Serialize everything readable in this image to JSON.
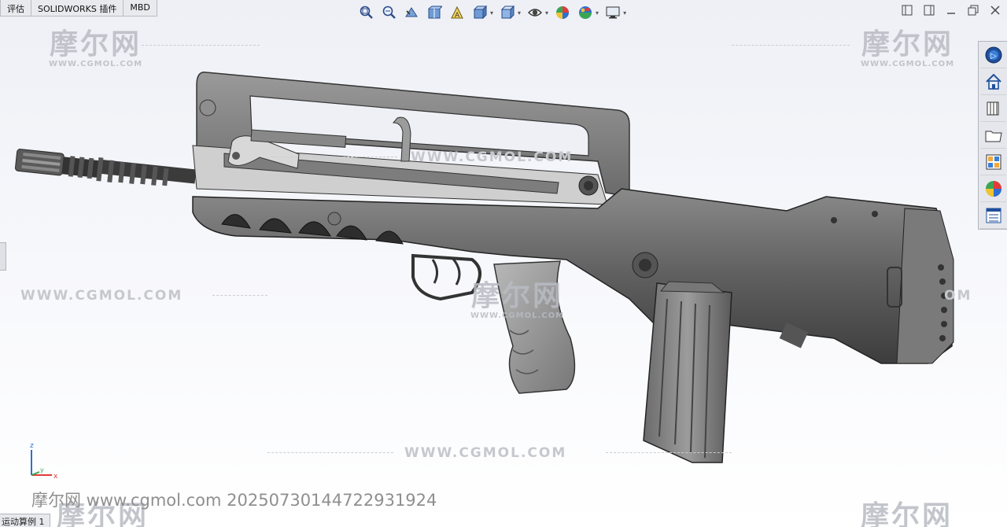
{
  "tabs": [
    "评估",
    "SOLIDWORKS 插件",
    "MBD"
  ],
  "hud_tools": [
    {
      "icon": "zoom-to-fit-icon",
      "caret": false
    },
    {
      "icon": "zoom-to-area-icon",
      "caret": false
    },
    {
      "icon": "previous-view-icon",
      "caret": false
    },
    {
      "icon": "section-view-icon",
      "caret": false
    },
    {
      "icon": "dynamic-annotation-views-icon",
      "caret": false
    },
    {
      "icon": "view-orientation-icon",
      "caret": true
    },
    {
      "icon": "display-style-icon",
      "caret": true
    },
    {
      "icon": "hide-show-items-icon",
      "caret": true
    },
    {
      "icon": "edit-appearance-icon",
      "caret": false
    },
    {
      "icon": "apply-scene-icon",
      "caret": true
    },
    {
      "icon": "view-settings-icon",
      "caret": true
    }
  ],
  "task_pane": [
    "solidworks-resources-icon",
    "home-icon",
    "design-library-icon",
    "file-explorer-icon",
    "view-palette-icon",
    "appearances-scenes-icon",
    "custom-properties-icon"
  ],
  "watermark": {
    "logo_text": "摩尔网",
    "logo_sub": "WWW.CGMOL.COM",
    "url_text": "WWW.CGMOL.COM"
  },
  "stamp": "摩尔网 www.cgmol.com 20250730144722931924",
  "bottom_tab": "运动算例 1",
  "triad": {
    "z": "z",
    "x": "x",
    "y": "y"
  }
}
